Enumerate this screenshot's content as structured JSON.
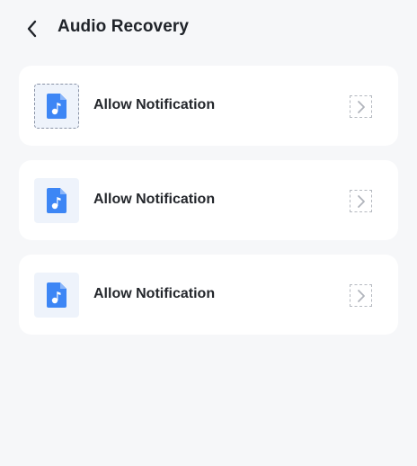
{
  "header": {
    "title": "Audio Recovery",
    "back_icon": "chevron-left-icon"
  },
  "items": [
    {
      "label": "Allow Notification",
      "icon": "music-file-icon",
      "selected": true
    },
    {
      "label": "Allow Notification",
      "icon": "music-file-icon",
      "selected": false
    },
    {
      "label": "Allow Notification",
      "icon": "music-file-icon",
      "selected": false
    }
  ],
  "colors": {
    "background": "#f6f7f9",
    "card": "#ffffff",
    "icon_blue": "#3d86f5",
    "icon_tile": "#eef3fb",
    "text": "#24272c"
  }
}
